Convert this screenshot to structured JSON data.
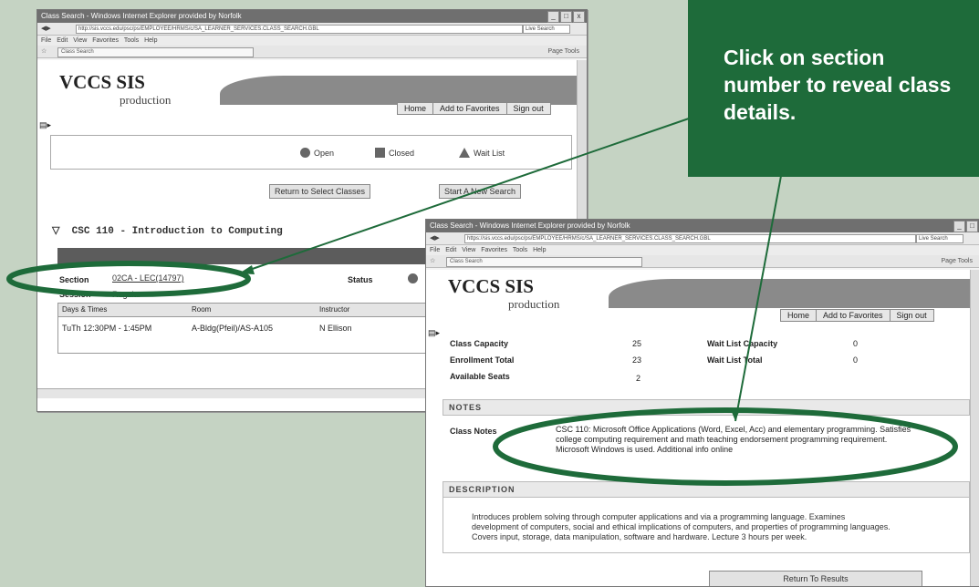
{
  "callout": {
    "text": "Click on section number to reveal class details."
  },
  "window1": {
    "title": "Class Search - Windows Internet Explorer provided by Norfolk",
    "address": "http://sis.vccs.edu/psc/ps/EMPLOYEE/HRMS/c/SA_LEARNER_SERVICES.CLASS_SEARCH.GBL",
    "search_placeholder": "Live Search",
    "menu": "File Edit View Favorites Tools Help",
    "tab": "Class Search",
    "toolbar_tools": "Page  Tools",
    "brand": "VCCS SIS",
    "brand_sub": "production",
    "nav": [
      "Home",
      "Add to Favorites",
      "Sign out"
    ],
    "legend": [
      "Open",
      "Closed",
      "Wait List"
    ],
    "buttons": [
      "Return to Select Classes",
      "Start A New Search"
    ],
    "course_title": "CSC 110 - Introduction to Computing",
    "section_label": "Section",
    "section_value": "02CA - LEC(14797)",
    "status_label": "Status",
    "session_label": "Session",
    "session_value": "Regular",
    "columns": [
      "Days & Times",
      "Room",
      "Instructor"
    ],
    "row": [
      "TuTh 12:30PM - 1:45PM",
      "A-Bldg(Pfeil)/AS-A105",
      "N Ellison"
    ]
  },
  "window2": {
    "title": "Class Search - Windows Internet Explorer provided by Norfolk",
    "address": "https://sis.vccs.edu/psc/ps/EMPLOYEE/HRMS/c/SA_LEARNER_SERVICES.CLASS_SEARCH.GBL",
    "search_placeholder": "Live Search",
    "menu": "File Edit View Favorites Tools Help",
    "tab": "Class Search",
    "toolbar_tools": "Page  Tools",
    "brand": "VCCS SIS",
    "brand_sub": "production",
    "nav": [
      "Home",
      "Add to Favorites",
      "Sign out"
    ],
    "capacity": {
      "class_capacity_label": "Class Capacity",
      "class_capacity": "25",
      "enrollment_total_label": "Enrollment Total",
      "enrollment_total": "23",
      "available_seats_label": "Available Seats",
      "available_seats": "2",
      "wait_list_capacity_label": "Wait List Capacity",
      "wait_list_capacity": "0",
      "wait_list_total_label": "Wait List Total",
      "wait_list_total": "0"
    },
    "notes_header": "NOTES",
    "class_notes_label": "Class Notes",
    "class_notes": "CSC 110: Microsoft Office Applications (Word, Excel, Acc) and elementary programming. Satisfies college computing requirement and math teaching endorsement programming requirement. Microsoft Windows is used. Additional info online",
    "description_header": "DESCRIPTION",
    "description": "Introduces problem solving through computer applications and via a programming language. Examines development of computers, social and ethical implications of computers, and properties of programming languages. Covers input, storage, data manipulation, software and hardware. Lecture 3 hours per week.",
    "return_button": "Return To Results"
  }
}
